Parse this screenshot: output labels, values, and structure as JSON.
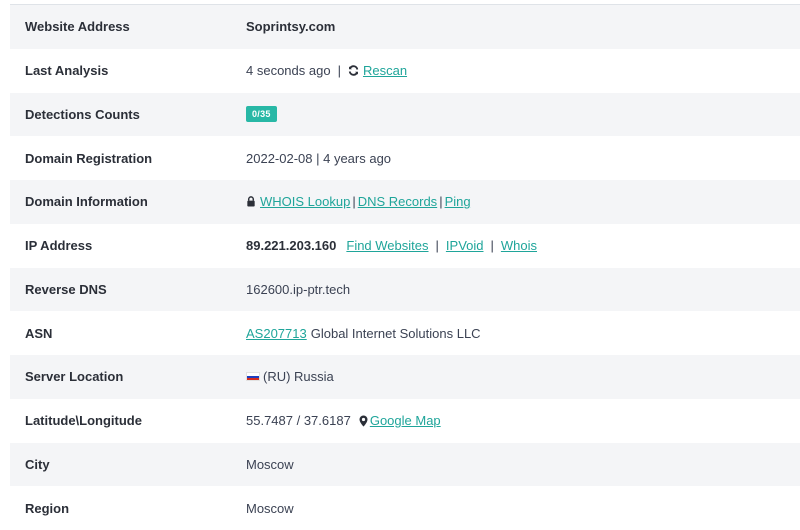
{
  "rows": {
    "website_address": {
      "label": "Website Address",
      "value": "Soprintsy.com"
    },
    "last_analysis": {
      "label": "Last Analysis",
      "value": "4 seconds ago",
      "sep": "|",
      "rescan": "Rescan",
      "icon": "refresh-icon"
    },
    "detections": {
      "label": "Detections Counts",
      "badge": "0/35",
      "badge_color": "#28b8a6"
    },
    "domain_registration": {
      "label": "Domain Registration",
      "value": "2022-02-08 | 4 years ago"
    },
    "domain_information": {
      "label": "Domain Information",
      "icon": "lock-icon",
      "whois": "WHOIS Lookup",
      "dns": "DNS Records",
      "ping": "Ping",
      "sep": "|"
    },
    "ip_address": {
      "label": "IP Address",
      "ip": "89.221.203.160",
      "find": "Find Websites",
      "ipvoid": "IPVoid",
      "whois": "Whois",
      "sep": "|"
    },
    "reverse_dns": {
      "label": "Reverse DNS",
      "value": "162600.ip-ptr.tech"
    },
    "asn": {
      "label": "ASN",
      "asn_link": "AS207713",
      "org": "Global Internet Solutions LLC"
    },
    "server_location": {
      "label": "Server Location",
      "flag": "russia-flag",
      "value": "(RU) Russia"
    },
    "lat_long": {
      "label": "Latitude\\Longitude",
      "value": "55.7487 / 37.6187",
      "icon": "map-marker-icon",
      "map_link": "Google Map"
    },
    "city": {
      "label": "City",
      "value": "Moscow"
    },
    "region": {
      "label": "Region",
      "value": "Moscow"
    }
  },
  "colors": {
    "link": "#1fa59a",
    "stripe": "#f4f5f7"
  }
}
